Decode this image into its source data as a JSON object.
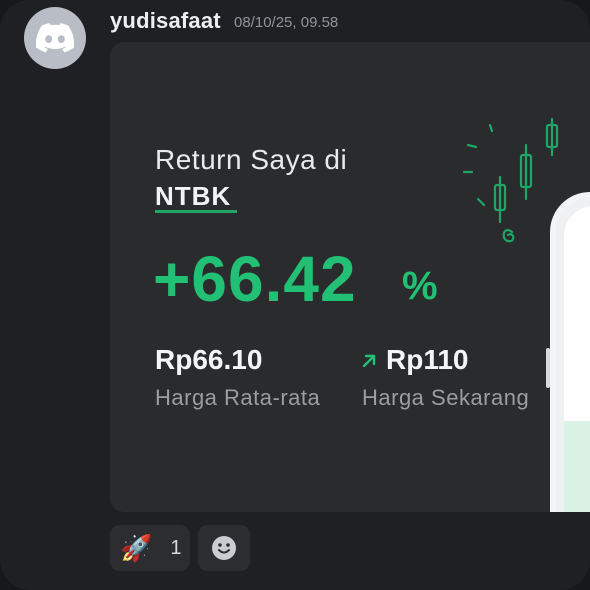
{
  "message": {
    "username": "yudisafaat",
    "timestamp": "08/10/25, 09.58",
    "avatar_icon": "discord-logo-icon"
  },
  "card": {
    "title": "Return Saya di",
    "ticker": "NTBK",
    "return_value": "+66.42",
    "return_unit": "%",
    "avg_price": "Rp66.10",
    "avg_label": "Harga Rata-rata",
    "current_price": "Rp110",
    "current_label": "Harga Sekarang",
    "accent_color": "#22c074",
    "trend_icon": "arrow-up-right-icon"
  },
  "reactions": {
    "items": [
      {
        "emoji": "🚀",
        "icon": "rocket-emoji-icon",
        "count": "1"
      }
    ],
    "add_icon": "add-reaction-smiley-icon"
  }
}
